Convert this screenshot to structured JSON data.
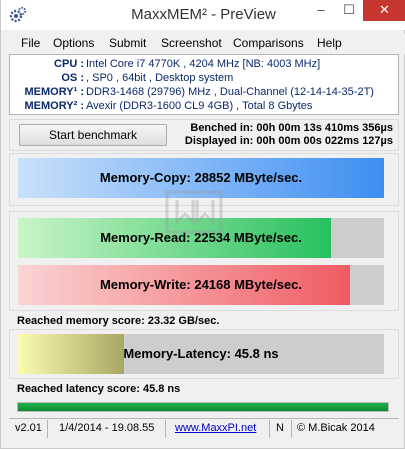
{
  "window": {
    "title": "MaxxMEM² - PreView",
    "minimize": "–",
    "maximize": "☐",
    "close": "✕"
  },
  "menu": [
    "File",
    "Options",
    "Submit",
    "Screenshot",
    "Comparisons",
    "Help"
  ],
  "sysinfo": {
    "rows": [
      {
        "label": "CPU :",
        "value": "Intel Core i7 4770K , 4204 MHz  [NB: 4003 MHz]"
      },
      {
        "label": "OS :",
        "value": ", SP0 , 64bit , Desktop system"
      },
      {
        "label": "MEMORY¹ :",
        "value": "DDR3-1468 (29796) MHz , Dual-Channel (12-14-14-35-2T)"
      },
      {
        "label": "MEMORY² :",
        "value": "Avexir (DDR3-1600 CL9 4GB) , Total 8 Gbytes"
      }
    ]
  },
  "benchmark": {
    "start_label": "Start benchmark",
    "benched": "Benched in: 00h 00m 13s 410ms 356µs",
    "displayed": "Displayed in: 00h 00m 00s 022ms 127µs"
  },
  "results": {
    "copy": {
      "label": "Memory-Copy: 28852 MByte/sec.",
      "fill": 1.0,
      "color_start": "#c9e1fb",
      "color_end": "#3d8ef2"
    },
    "read": {
      "label": "Memory-Read: 22534 MByte/sec.",
      "fill": 0.854,
      "color_start": "#c9f5c6",
      "color_end": "#27c05e"
    },
    "write": {
      "label": "Memory-Write: 24168 MByte/sec.",
      "fill": 0.906,
      "color_start": "#fbd4d4",
      "color_end": "#ef5b62"
    },
    "latency": {
      "label": "Memory-Latency: 45.8 ns",
      "fill": 0.29,
      "color_start": "#fbfbb0",
      "color_end": "#a8a864"
    }
  },
  "memory_score": "Reached memory score: 23.32 GB/sec.",
  "latency_score": "Reached latency score: 45.8 ns",
  "progress": 1.0,
  "status": {
    "version": "v2.01",
    "date": "1/4/2014 - 19.08.55",
    "link": "www.MaxxPI.net",
    "mode": "N",
    "copyright": "© M.Bicak 2014"
  }
}
